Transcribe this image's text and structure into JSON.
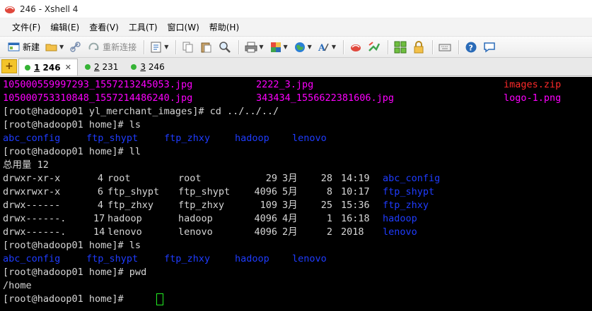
{
  "window": {
    "title": "246 - Xshell 4"
  },
  "menu": [
    "文件(F)",
    "编辑(E)",
    "查看(V)",
    "工具(T)",
    "窗口(W)",
    "帮助(H)"
  ],
  "toolbar": {
    "new_label": "新建",
    "reconnect_label": "重新连接"
  },
  "tabs": [
    {
      "num": "1",
      "name": "246",
      "active": true
    },
    {
      "num": "2",
      "name": "231",
      "active": false
    },
    {
      "num": "3",
      "name": "246",
      "active": false
    }
  ],
  "terminal": {
    "ls_files": {
      "col1": [
        "105000559997293_1557213245053.jpg",
        "105000753310848_1557214486240.jpg"
      ],
      "col2": [
        "2222_3.jpg",
        "343434_1556622381606.jpg"
      ],
      "col3": [
        "images.zip",
        "logo-1.png"
      ]
    },
    "prompt1": "[root@hadoop01 yl_merchant_images]# cd ../../../",
    "prompt2": "[root@hadoop01 home]# ls",
    "dirs": [
      "abc_config",
      "ftp_shypt",
      "ftp_zhxy",
      "hadoop",
      "lenovo"
    ],
    "prompt3": "[root@hadoop01 home]# ll",
    "total": "总用量 12",
    "ll_rows": [
      {
        "perm": "drwxr-xr-x",
        "links": "4",
        "user": "root",
        "group": "root",
        "size": "29",
        "month": "3月",
        "day": "28",
        "time": "14:19",
        "name": "abc_config"
      },
      {
        "perm": "drwxrwxr-x",
        "links": "6",
        "user": "ftp_shypt",
        "group": "ftp_shypt",
        "size": "4096",
        "month": "5月",
        "day": "8",
        "time": "10:17",
        "name": "ftp_shypt"
      },
      {
        "perm": "drwx------",
        "links": "4",
        "user": "ftp_zhxy",
        "group": "ftp_zhxy",
        "size": "109",
        "month": "3月",
        "day": "25",
        "time": "15:36",
        "name": "ftp_zhxy"
      },
      {
        "perm": "drwx------.",
        "links": "17",
        "user": "hadoop",
        "group": "hadoop",
        "size": "4096",
        "month": "4月",
        "day": "1",
        "time": "16:18",
        "name": "hadoop"
      },
      {
        "perm": "drwx------.",
        "links": "14",
        "user": "lenovo",
        "group": "lenovo",
        "size": "4096",
        "month": "2月",
        "day": "2",
        "time": "2018",
        "name": "lenovo"
      }
    ],
    "prompt4": "[root@hadoop01 home]# ls",
    "prompt5": "[root@hadoop01 home]# pwd",
    "pwd_out": "/home",
    "prompt6": "[root@hadoop01 home]# "
  },
  "colors": {
    "magenta": "#ff00ff",
    "red": "#ff2a2a",
    "blue": "#1f3cff",
    "cursor": "#22ee22"
  },
  "icons": [
    "xshell-icon",
    "new-session-icon",
    "open-folder-icon",
    "reconnect-icon",
    "properties-icon",
    "copy-icon",
    "paste-icon",
    "find-icon",
    "print-icon",
    "transfer-icon",
    "globe-icon",
    "font-icon",
    "xftp-icon",
    "compose-icon",
    "layout-icon",
    "lock-icon",
    "keyboard-icon",
    "help-icon",
    "chat-icon"
  ]
}
